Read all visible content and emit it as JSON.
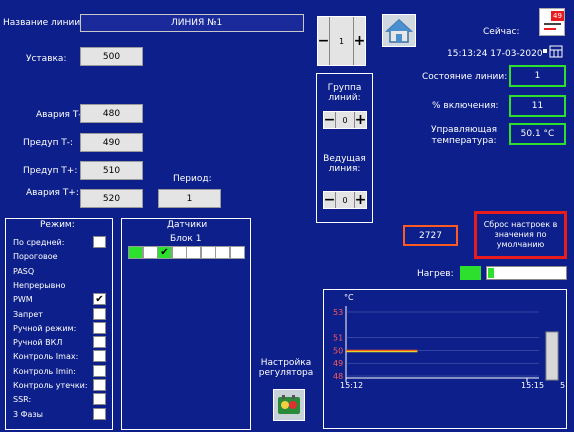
{
  "line": {
    "name_label": "Название линии:",
    "name_value": "ЛИНИЯ №1"
  },
  "setpoint": {
    "label": "Уставка:",
    "value": "500"
  },
  "limits": [
    {
      "label": "Авария Т-:",
      "value": "480"
    },
    {
      "label": "Предуп Т-:",
      "value": "490"
    },
    {
      "label": "Предуп Т+:",
      "value": "510"
    },
    {
      "label": "Авария Т+:",
      "value": "520"
    }
  ],
  "period": {
    "label": "Период:",
    "value": "1"
  },
  "line_stepper": {
    "value": "1",
    "minus": "−",
    "plus": "+"
  },
  "group": {
    "label": "Группа линий:",
    "value": "0"
  },
  "leading": {
    "label": "Ведущая линия:",
    "value": "0"
  },
  "now": {
    "label": "Сейчас:",
    "datetime": "15:13:24 17-03-2020",
    "badge": "49"
  },
  "status": [
    {
      "label": "Состояние линии:",
      "value": "1"
    },
    {
      "label": "% включения:",
      "value": "11"
    },
    {
      "label": "Управляющая температура:",
      "value": "50.1 °C"
    }
  ],
  "counter": {
    "value": "2727"
  },
  "reset": {
    "label": "Сброс настроек в значения по умолчанию"
  },
  "heating": {
    "label": "Нагрев:"
  },
  "regulator": {
    "label": "Настройка регулятора"
  },
  "modes": {
    "title": "Режим:",
    "items": [
      {
        "label": "По средней:",
        "checkbox": true,
        "checked": false
      },
      {
        "label": "Пороговое",
        "checkbox": false,
        "checked": false
      },
      {
        "label": "PASQ",
        "checkbox": false,
        "checked": false
      },
      {
        "label": "Непрерывно",
        "checkbox": false,
        "checked": false
      },
      {
        "label": "PWM",
        "checkbox": true,
        "checked": true
      },
      {
        "label": "Запрет",
        "checkbox": true,
        "checked": false
      },
      {
        "label": "Ручной режим:",
        "checkbox": true,
        "checked": false
      },
      {
        "label": "Ручной ВКЛ",
        "checkbox": true,
        "checked": false
      },
      {
        "label": "Контроль Imax:",
        "checkbox": true,
        "checked": false
      },
      {
        "label": "Контроль Imin:",
        "checkbox": true,
        "checked": false
      },
      {
        "label": "Контроль утечки:",
        "checkbox": true,
        "checked": false
      },
      {
        "label": "SSR:",
        "checkbox": true,
        "checked": false
      },
      {
        "label": "3 Фазы",
        "checkbox": true,
        "checked": false
      }
    ]
  },
  "sensors": {
    "title": "Датчики",
    "block_label": "Блок 1",
    "cells": [
      "green",
      "white",
      "checked",
      "white",
      "white",
      "white",
      "white",
      "white"
    ]
  },
  "colors": {
    "bg": "#0d1f8a",
    "green": "#2ee02e",
    "red": "#e81c1c",
    "orange": "#ff5a1f"
  },
  "chart_data": {
    "type": "line",
    "ylabel": "°C",
    "yticks": [
      "53",
      "51",
      "50",
      "49",
      "48"
    ],
    "ylim": [
      48,
      53
    ],
    "xticks": [
      "15:12",
      "15:15"
    ],
    "xtick_extra": "5",
    "series": [
      {
        "values": [
          50,
          50,
          50,
          50
        ],
        "x_fraction": [
          0,
          0.1,
          0.2,
          0.37
        ],
        "color": "#ff5a1f"
      },
      {
        "values": [
          50,
          50,
          50,
          50
        ],
        "x_fraction": [
          0,
          0.1,
          0.2,
          0.37
        ],
        "color": "#d6d62e"
      }
    ]
  }
}
